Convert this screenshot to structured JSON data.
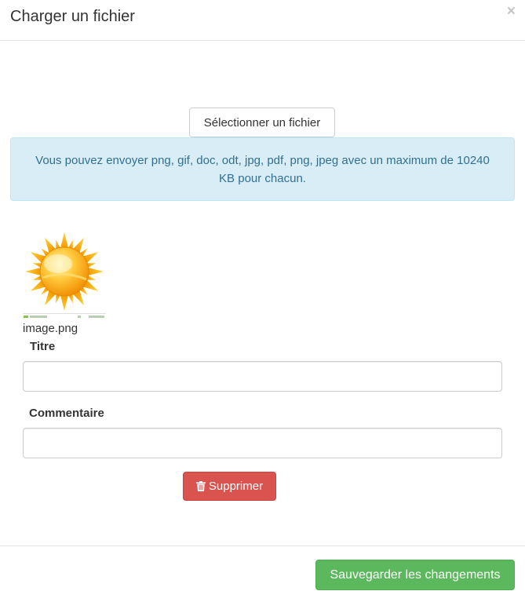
{
  "header": {
    "title": "Charger un fichier",
    "close_label": "×"
  },
  "upload": {
    "select_label": "Sélectionner un fichier",
    "info_text": "Vous pouvez envoyer png, gif, doc, odt, jpg, pdf, png, jpeg avec un maximum de 10240 KB pour chacun."
  },
  "file": {
    "name": "image.png",
    "thumbnail_icon": "sun-icon"
  },
  "form": {
    "title_label": "Titre",
    "title_value": "",
    "comment_label": "Commentaire",
    "comment_value": ""
  },
  "actions": {
    "delete_label": "Supprimer",
    "delete_icon": "trash-icon",
    "save_label": "Sauvegarder les changements"
  },
  "colors": {
    "info_bg": "#d9edf7",
    "info_text": "#31708f",
    "danger": "#d9534f",
    "success": "#5cb85c"
  }
}
